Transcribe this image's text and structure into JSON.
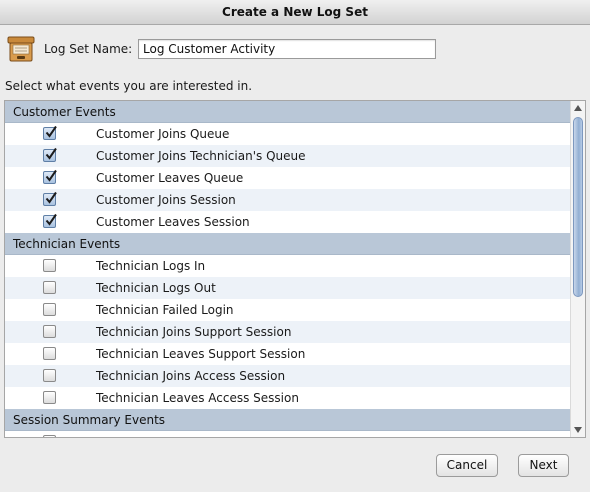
{
  "window": {
    "title": "Create a New Log Set"
  },
  "header": {
    "icon": "archive-box-icon",
    "name_label": "Log Set Name:",
    "name_value": "Log Customer Activity"
  },
  "instructions": "Select what events you are interested in.",
  "groups": [
    {
      "title": "Customer Events",
      "items": [
        {
          "label": "Customer Joins Queue",
          "checked": true
        },
        {
          "label": "Customer Joins Technician's Queue",
          "checked": true
        },
        {
          "label": "Customer Leaves Queue",
          "checked": true
        },
        {
          "label": "Customer Joins Session",
          "checked": true
        },
        {
          "label": "Customer Leaves Session",
          "checked": true
        }
      ]
    },
    {
      "title": "Technician Events",
      "items": [
        {
          "label": "Technician Logs In",
          "checked": false
        },
        {
          "label": "Technician Logs Out",
          "checked": false
        },
        {
          "label": "Technician Failed Login",
          "checked": false
        },
        {
          "label": "Technician Joins Support Session",
          "checked": false
        },
        {
          "label": "Technician Leaves Support Session",
          "checked": false
        },
        {
          "label": "Technician Joins Access Session",
          "checked": false
        },
        {
          "label": "Technician Leaves Access Session",
          "checked": false
        }
      ]
    },
    {
      "title": "Session Summary Events",
      "items": [
        {
          "label": "",
          "checked": false
        }
      ]
    }
  ],
  "buttons": {
    "cancel": "Cancel",
    "next": "Next"
  },
  "colors": {
    "group_header_bg": "#b9c7d7",
    "row_alt_bg": "#edf2f8",
    "window_bg": "#ececec"
  }
}
